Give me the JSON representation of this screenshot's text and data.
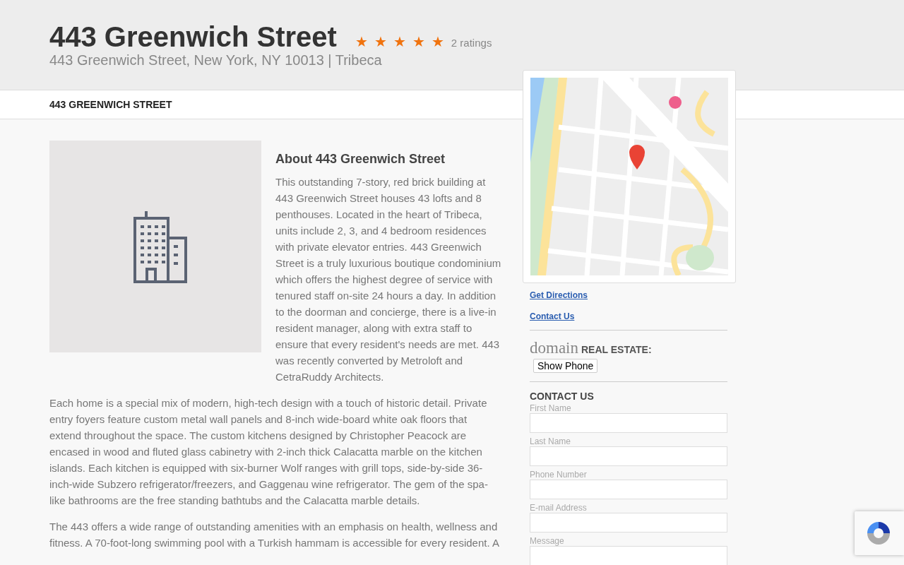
{
  "header": {
    "title": "443 Greenwich Street",
    "rating": {
      "stars": 5,
      "count": "2 ratings"
    },
    "address": "443 Greenwich Street, New York, NY 10013 | Tribeca"
  },
  "nav": {
    "label": "443 GREENWICH STREET"
  },
  "about": {
    "heading": "About 443 Greenwich Street",
    "paragraphs": [
      "This outstanding 7-story, red brick building at 443 Greenwich Street houses 43 lofts and 8 penthouses. Located in the heart of Tribeca, units include 2, 3, and 4 bedroom residences with private elevator entries. 443 Greenwich Street is a truly luxurious boutique condominium which offers the highest degree of service with tenured staff on-site 24 hours a day. In addition to the doorman and concierge, there is a live-in resident manager, along with extra staff to ensure that every resident's needs are met. 443 was recently converted by Metroloft and CetraRuddy Architects.",
      "Each home is a special mix of modern, high-tech design with a touch of historic detail. Private entry foyers feature custom metal wall panels and 8-inch wide-board white oak floors that extend throughout the space. The custom kitchens designed by Christopher Peacock are encased in wood and fluted glass cabinetry with 2-inch thick Calacatta marble on the kitchen islands. Each kitchen is equipped with six-burner Wolf ranges with grill tops, side-by-side 36-inch-wide Subzero refrigerator/freezers, and Gaggenau wine refrigerator. The gem of the spa-like bathrooms are the free standing bathtubs and the Calacatta marble details.",
      "The 443 offers a wide range of outstanding amenities with an emphasis on health, wellness and fitness. A 70-foot-long swimming pool with a Turkish hammam is accessible for every resident. A"
    ]
  },
  "sidebar": {
    "links": [
      "Get Directions",
      "Contact Us"
    ],
    "agent": {
      "logo": "domain",
      "label": "REAL ESTATE:",
      "button": "Show Phone"
    },
    "contact_form": {
      "heading": "CONTACT US",
      "fields": [
        {
          "label": "First Name",
          "kind": "input"
        },
        {
          "label": "Last Name",
          "kind": "input"
        },
        {
          "label": "Phone Number",
          "kind": "input"
        },
        {
          "label": "E-mail Address",
          "kind": "input"
        },
        {
          "label": "Message",
          "kind": "textarea"
        }
      ]
    }
  }
}
